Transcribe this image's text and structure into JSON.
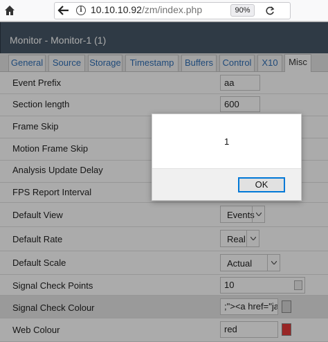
{
  "browser": {
    "url_host": "10.10.10.92",
    "url_path": "/zm/index.php",
    "zoom": "90%"
  },
  "page": {
    "title": "Monitor - Monitor-1 (1)"
  },
  "tabs": [
    {
      "label": "General"
    },
    {
      "label": "Source"
    },
    {
      "label": "Storage"
    },
    {
      "label": "Timestamp"
    },
    {
      "label": "Buffers"
    },
    {
      "label": "Control"
    },
    {
      "label": "X10"
    },
    {
      "label": "Misc"
    }
  ],
  "active_tab": "Misc",
  "rows": {
    "event_prefix": {
      "label": "Event Prefix",
      "value": "aa"
    },
    "section_length": {
      "label": "Section length",
      "value": "600"
    },
    "frame_skip": {
      "label": "Frame Skip"
    },
    "motion_frame_skip": {
      "label": "Motion Frame Skip"
    },
    "analysis_update_delay": {
      "label": "Analysis Update Delay"
    },
    "fps_report_interval": {
      "label": "FPS Report Interval"
    },
    "default_view": {
      "label": "Default View",
      "value": "Events"
    },
    "default_rate": {
      "label": "Default Rate",
      "value": "Real"
    },
    "default_scale": {
      "label": "Default Scale",
      "value": "Actual"
    },
    "signal_check_points": {
      "label": "Signal Check Points",
      "value": "10"
    },
    "signal_check_colour": {
      "label": "Signal Check Colour",
      "value": ";\"><a href=\"jav",
      "swatch_color": "#d6d6d6"
    },
    "web_colour": {
      "label": "Web Colour",
      "value": "red",
      "swatch_color": "#e53a3a"
    }
  },
  "dialog": {
    "message": "1",
    "ok_label": "OK"
  }
}
